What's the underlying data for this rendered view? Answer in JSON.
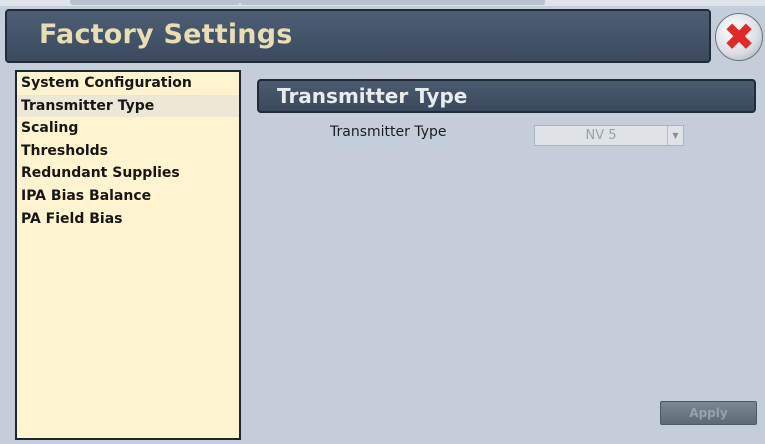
{
  "header": {
    "title": "Factory Settings"
  },
  "close_icon": "close-icon",
  "sidebar": {
    "items": [
      {
        "label": "System Configuration"
      },
      {
        "label": "Transmitter Type",
        "selected": true
      },
      {
        "label": "Scaling"
      },
      {
        "label": "Thresholds"
      },
      {
        "label": "Redundant Supplies"
      },
      {
        "label": "IPA Bias Balance"
      },
      {
        "label": "PA Field Bias"
      }
    ]
  },
  "panel": {
    "title": "Transmitter Type",
    "field_label": "Transmitter Type",
    "dropdown_value": "NV 5",
    "apply_label": "Apply"
  },
  "colors": {
    "header_bg": "#425268",
    "header_text": "#e8ddb4",
    "sidebar_bg": "#fff4cf",
    "content_bg": "#c4cedb",
    "close_x": "#e0292a"
  }
}
